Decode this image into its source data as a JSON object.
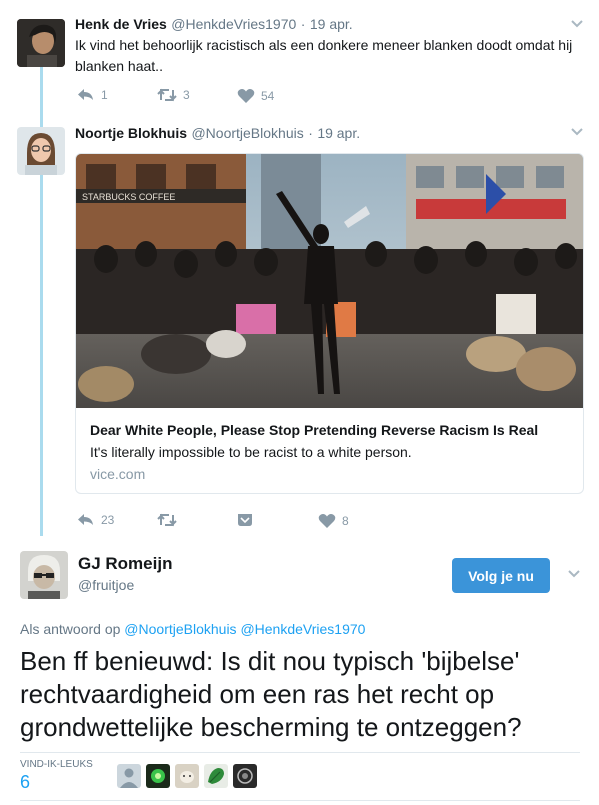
{
  "tweet1": {
    "name": "Henk de Vries",
    "handle": "@HenkdeVries1970",
    "separator": "·",
    "date": "19 apr.",
    "text_line1": "Ik vind het behoorlijk racistisch als een donkere meneer blanken doodt omdat hij",
    "text_line2": "blanken haat..",
    "replies": "1",
    "retweets": "3",
    "likes": "54"
  },
  "tweet2": {
    "name": "Noortje Blokhuis",
    "handle": "@NoortjeBlokhuis",
    "separator": "·",
    "date": "19 apr.",
    "card": {
      "title": "Dear White People, Please Stop Pretending Reverse Racism Is Real",
      "description": "It's literally impossible to be racist to a white person.",
      "domain": "vice.com",
      "photo_signage": "STARBUCKS COFFEE"
    },
    "replies": "23",
    "likes": "8"
  },
  "main_tweet": {
    "name": "GJ Romeijn",
    "handle": "@fruitjoe",
    "follow_label": "Volg je nu",
    "reply_prefix": "Als antwoord op",
    "reply_to_1": "@NoortjeBlokhuis",
    "reply_to_2": "@HenkdeVries1970",
    "text": "Ben ff benieuwd: Is dit nou typisch 'bijbelse' rechtvaardigheid om een ras het recht op grondwettelijke bescherming te ontzeggen?",
    "likes_label": "VIND-IK-LEUKS",
    "likes_count": "6"
  },
  "colors": {
    "link": "#1da1f2",
    "button": "#3b94d9",
    "muted": "#657786",
    "icon": "#8899a6",
    "thread_line": "#aadbee"
  }
}
